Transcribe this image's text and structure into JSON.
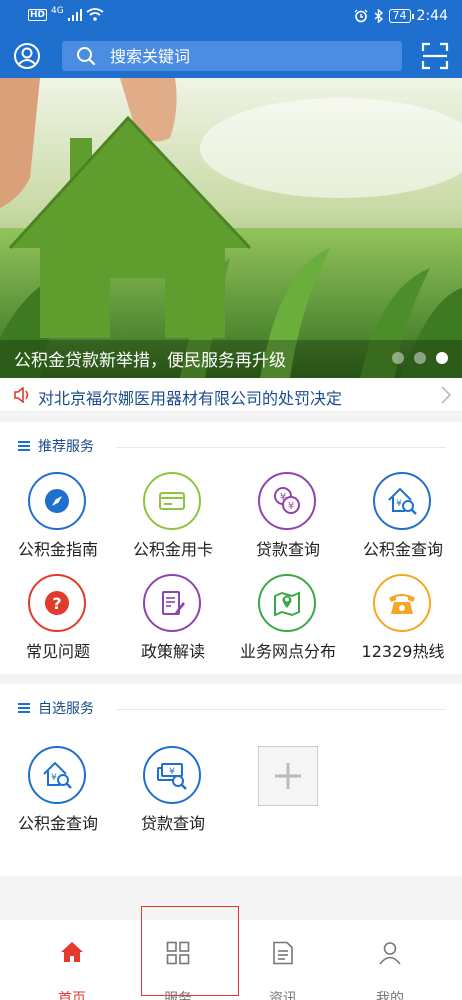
{
  "status_bar": {
    "network_badge": "HD",
    "network_type": "4G",
    "time": "2:44",
    "battery": "74"
  },
  "top_bar": {
    "search_placeholder": "搜索关键词",
    "user_icon": "user-icon",
    "scan_icon": "scan-icon"
  },
  "banner": {
    "caption": "公积金贷款新举措，便民服务再升级",
    "slide_count": 3,
    "active_slide": 3
  },
  "notice": {
    "text": "对北京福尔娜医用器材有限公司的处罚决定"
  },
  "recommended": {
    "title": "推荐服务",
    "items": [
      {
        "label": "公积金指南",
        "icon": "compass-icon",
        "color": "#1f6fcf"
      },
      {
        "label": "公积金用卡",
        "icon": "card-icon",
        "color": "#8cc63f"
      },
      {
        "label": "贷款查询",
        "icon": "yen-coins-icon",
        "color": "#8e44ad"
      },
      {
        "label": "公积金查询",
        "icon": "house-search-icon",
        "color": "#1f6fcf"
      },
      {
        "label": "常见问题",
        "icon": "question-icon",
        "color": "#e23a2c"
      },
      {
        "label": "政策解读",
        "icon": "document-pen-icon",
        "color": "#8e44ad"
      },
      {
        "label": "业务网点分布",
        "icon": "map-pin-icon",
        "color": "#3aa845"
      },
      {
        "label": "12329热线",
        "icon": "telephone-icon",
        "color": "#f5a623"
      }
    ]
  },
  "custom": {
    "title": "自选服务",
    "items": [
      {
        "label": "公积金查询",
        "icon": "house-search-icon",
        "color": "#1f6fcf"
      },
      {
        "label": "贷款查询",
        "icon": "money-search-icon",
        "color": "#1f6fcf"
      }
    ],
    "add_icon": "plus-icon"
  },
  "tabs": [
    {
      "label": "首页",
      "icon": "home-icon",
      "active": true
    },
    {
      "label": "服务",
      "icon": "grid-icon",
      "active": false
    },
    {
      "label": "资讯",
      "icon": "news-icon",
      "active": false
    },
    {
      "label": "我的",
      "icon": "profile-icon",
      "active": false
    }
  ],
  "colors": {
    "brand_blue": "#1f6fcf",
    "active_red": "#e23a2c"
  }
}
